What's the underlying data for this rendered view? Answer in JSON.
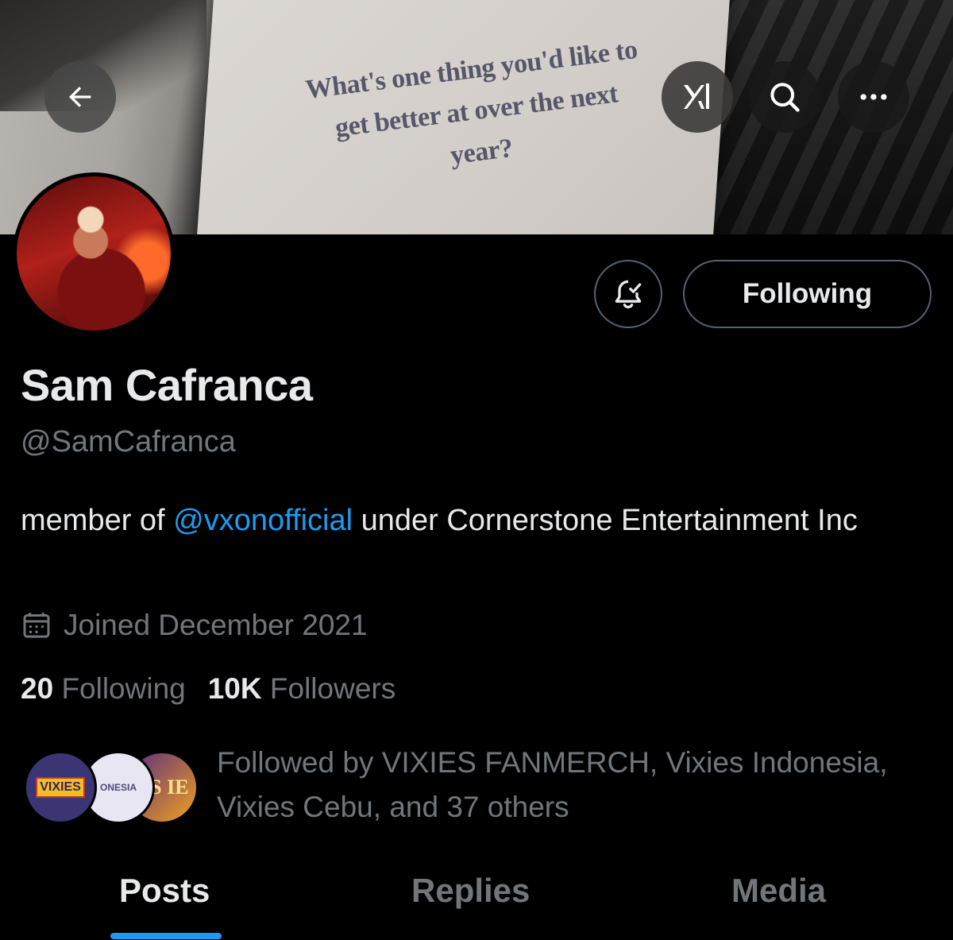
{
  "banner": {
    "card_text": "What's one thing you'd like to get better at over the next year?"
  },
  "header_actions": {
    "back_icon": "arrow-left-icon",
    "grok_icon": "grok-icon",
    "search_icon": "search-icon",
    "more_icon": "more-horizontal-icon"
  },
  "profile": {
    "display_name": "Sam Cafranca",
    "handle": "@SamCafranca",
    "bio_prefix": "member of ",
    "bio_mention": "@vxonofficial",
    "bio_suffix": " under Cornerstone Entertainment Inc",
    "joined": "Joined December 2021",
    "following_count": "20",
    "following_label": "Following",
    "followers_count": "10K",
    "followers_label": "Followers"
  },
  "actions": {
    "notifications_icon": "bell-check-icon",
    "following_button": "Following"
  },
  "followed_by": {
    "avatar_labels": [
      "VIXIES",
      "ONESIA",
      "VS IE"
    ],
    "text": "Followed by VIXIES FANMERCH, Vixies Indonesia, Vixies Cebu, and 37 others"
  },
  "tabs": [
    {
      "label": "Posts",
      "active": true
    },
    {
      "label": "Replies",
      "active": false
    },
    {
      "label": "Media",
      "active": false
    }
  ],
  "colors": {
    "accent": "#1d9bf0",
    "background": "#000000",
    "muted_text": "#71767b",
    "primary_text": "#e7e9ea"
  }
}
